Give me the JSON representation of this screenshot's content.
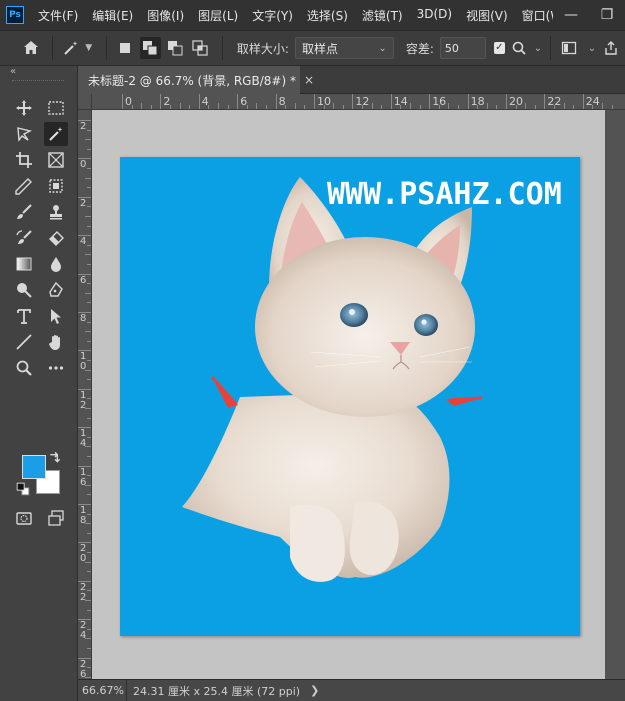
{
  "app": {
    "logo_text": "Ps"
  },
  "menu": {
    "items": [
      "文件(F)",
      "编辑(E)",
      "图像(I)",
      "图层(L)",
      "文字(Y)",
      "选择(S)",
      "滤镜(T)",
      "3D(D)",
      "视图(V)",
      "窗口(W"
    ]
  },
  "window_controls": {
    "minimize": "—",
    "restore": "❐"
  },
  "options": {
    "sample_size_label": "取样大小:",
    "sample_size_value": "取样点",
    "tolerance_label": "容差:",
    "tolerance_value": "50",
    "antialias_checked": "✓"
  },
  "toolbar": {
    "collapse": "«"
  },
  "doc_tab": {
    "title": "未标题-2 @ 66.7% (背景, RGB/8#) *",
    "close": "×"
  },
  "ruler_h_labels": [
    "0",
    "2",
    "4",
    "6",
    "8",
    "10",
    "12",
    "14",
    "16",
    "18",
    "20",
    "22",
    "24"
  ],
  "ruler_v_labels": [
    "2",
    "0",
    "2",
    "4",
    "6",
    "8",
    "1\n0",
    "1\n2",
    "1\n4",
    "1\n6",
    "1\n8",
    "2\n0",
    "2\n2",
    "2\n4",
    "2\n6"
  ],
  "canvas": {
    "background_color": "#0ba0e3",
    "watermark": "WWW.PSAHZ.COM"
  },
  "colors": {
    "foreground": "#1a9ee6",
    "background": "#ffffff"
  },
  "status": {
    "zoom": "66.67%",
    "doc_info": "24.31 厘米 x 25.4 厘米 (72 ppi)",
    "arrow": "❯"
  }
}
